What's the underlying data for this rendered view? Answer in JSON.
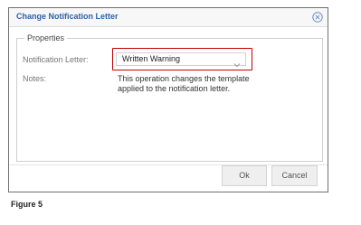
{
  "dialog": {
    "title": "Change Notification Letter",
    "close_icon": "close-icon"
  },
  "properties": {
    "legend": "Properties",
    "notification_letter_label": "Notification Letter:",
    "notification_letter_value": "Written Warning",
    "dropdown_icon": "chevron-down-icon",
    "notes_label": "Notes:",
    "notes_text": "This operation changes the template applied to the notification letter."
  },
  "buttons": {
    "ok_label": "Ok",
    "cancel_label": "Cancel"
  },
  "figure_caption": "Figure 5",
  "colors": {
    "title": "#2e62a8",
    "highlight": "#c00000"
  }
}
